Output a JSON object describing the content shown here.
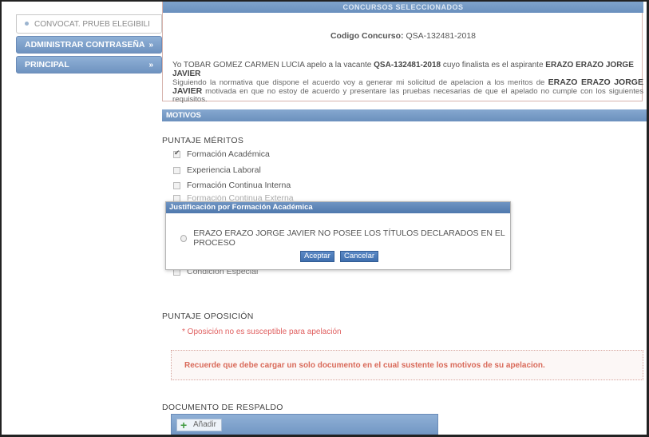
{
  "sidebar": {
    "sub_item": "CONVOCAT. PRUEB ELEGIBILI",
    "items": [
      {
        "label": "ADMINISTRAR CONTRASEÑA",
        "chevron": "»"
      },
      {
        "label": "PRINCIPAL",
        "chevron": "»"
      }
    ]
  },
  "concursos": {
    "header": "CONCURSOS SELECCIONADOS",
    "codigo_label": "Codigo Concurso:",
    "codigo_value": "QSA-132481-2018",
    "apelo_prefix": "Yo TOBAR GOMEZ CARMEN LUCIA apelo a la vacante ",
    "apelo_vacante": "QSA-132481-2018",
    "apelo_middle": " cuyo finalista es el aspirante ",
    "apelo_aspirante": "ERAZO ERAZO JORGE JAVIER",
    "seguimiento_prefix": "Siguiendo la normativa que dispone el acuerdo voy a generar mi solicitud de apelacion a los meritos de ",
    "seguimiento_name": "ERAZO ERAZO JORGE JAVIER",
    "seguimiento_suffix": " motivada en que no estoy de acuerdo y presentare las pruebas necesarias de que el apelado no cumple con los siguientes requisitos."
  },
  "motivos": {
    "header": "MOTIVOS",
    "puntaje_meritos_title": "PUNTAJE MÉRITOS",
    "checks": [
      {
        "label": "Formación Académica",
        "checked": true
      },
      {
        "label": "Experiencia Laboral",
        "checked": false
      },
      {
        "label": "Formación Continua Interna",
        "checked": false
      },
      {
        "label": "Formación Continua Externa",
        "checked": false
      },
      {
        "label": "Condición Especial",
        "checked": false
      }
    ],
    "puntaje_oposicion_title": "PUNTAJE OPOSICIÓN",
    "oposicion_note": "* Oposición no es susceptible para apelación",
    "warning": "Recuerde que debe cargar un solo documento en el cual sustente los motivos de su apelacion.",
    "documento_title": "DOCUMENTO DE RESPALDO",
    "add_label": "Añadir"
  },
  "modal": {
    "title": "Justificación por Formación Académica",
    "option": "ERAZO ERAZO JORGE JAVIER NO POSEE LOS TÍTULOS DECLARADOS EN EL PROCESO",
    "accept": "Aceptar",
    "cancel": "Cancelar"
  },
  "colors": {
    "accent": "#6f93c0",
    "warning_text": "#d96a5a",
    "note_text": "#e06060"
  }
}
